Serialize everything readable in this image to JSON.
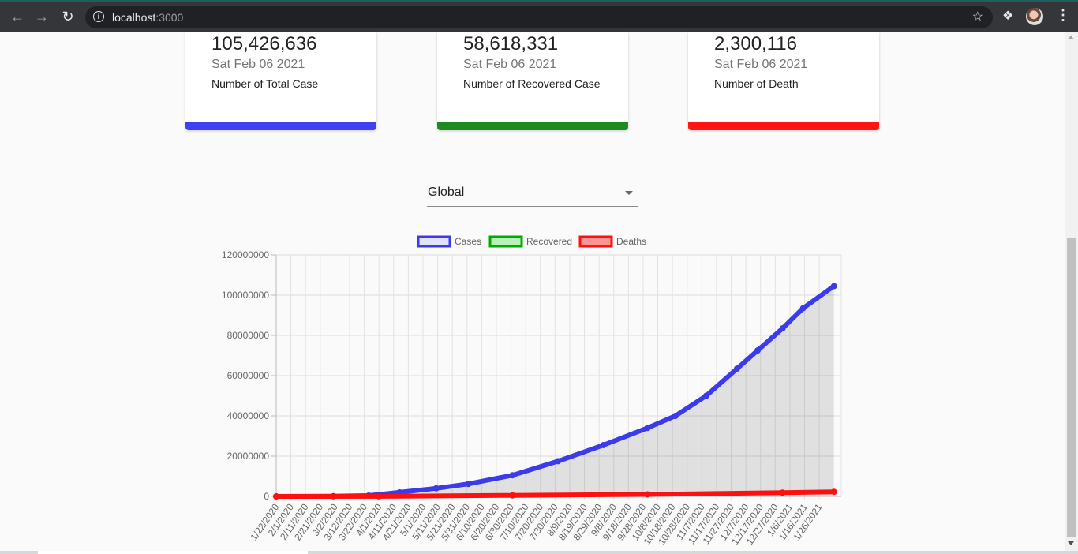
{
  "browser": {
    "url_host": "localhost",
    "url_port": ":3000"
  },
  "cards": [
    {
      "number": "105,426,636",
      "date": "Sat Feb 06 2021",
      "label": "Number of Total Case",
      "color": "#4040f0"
    },
    {
      "number": "58,618,331",
      "date": "Sat Feb 06 2021",
      "label": "Number of Recovered Case",
      "color": "#1e8a22"
    },
    {
      "number": "2,300,116",
      "date": "Sat Feb 06 2021",
      "label": "Number of Death",
      "color": "#ff1414"
    }
  ],
  "country_select": {
    "value": "Global"
  },
  "chart_data": {
    "type": "line",
    "legend_position": "top",
    "grid": true,
    "legend": [
      {
        "name": "Cases",
        "color": "#3b3bea",
        "fill": "rgba(90,90,240,0.15)"
      },
      {
        "name": "Recovered",
        "color": "#00aa00",
        "fill": "rgba(60,220,60,0.35)"
      },
      {
        "name": "Deaths",
        "color": "#ff1010",
        "fill": "rgba(255,80,80,0.6)"
      }
    ],
    "ylim": [
      0,
      120000000
    ],
    "yticks": [
      0,
      20000000,
      40000000,
      60000000,
      80000000,
      100000000,
      120000000
    ],
    "ytick_labels": [
      "0",
      "20000000",
      "40000000",
      "60000000",
      "80000000",
      "100000000",
      "120000000"
    ],
    "xtick_labels": [
      "1/22/2020",
      "2/1/2020",
      "2/11/2020",
      "2/21/2020",
      "3/2/2020",
      "3/12/2020",
      "3/22/2020",
      "4/1/2020",
      "4/11/2020",
      "4/21/2020",
      "5/1/2020",
      "5/11/2020",
      "5/21/2020",
      "5/31/2020",
      "6/10/2020",
      "6/20/2020",
      "6/30/2020",
      "7/10/2020",
      "7/20/2020",
      "7/30/2020",
      "8/9/2020",
      "8/19/2020",
      "8/29/2020",
      "9/8/2020",
      "9/18/2020",
      "9/28/2020",
      "10/8/2020",
      "10/18/2020",
      "10/28/2020",
      "11/7/2020",
      "11/17/2020",
      "11/27/2020",
      "12/7/2020",
      "12/17/2020",
      "12/27/2020",
      "1/6/2021",
      "1/16/2021",
      "1/26/2021"
    ],
    "series": [
      {
        "name": "Cases",
        "color": "#3b3bea",
        "x": [
          "1/22/2020",
          "3/1/2020",
          "3/25/2020",
          "4/15/2020",
          "5/10/2020",
          "6/1/2020",
          "7/1/2020",
          "8/1/2020",
          "9/1/2020",
          "10/1/2020",
          "10/20/2020",
          "11/10/2020",
          "12/1/2020",
          "12/15/2020",
          "1/1/2021",
          "1/15/2021",
          "2/5/2021"
        ],
        "values": [
          1000,
          90000,
          400000,
          2000000,
          4000000,
          6200000,
          10500000,
          17500000,
          25500000,
          34000000,
          40000000,
          50000000,
          63500000,
          72500000,
          83500000,
          93500000,
          104500000
        ]
      },
      {
        "name": "Deaths",
        "color": "#ff1010",
        "x": [
          "1/22/2020",
          "4/1/2020",
          "7/1/2020",
          "10/1/2020",
          "1/1/2021",
          "2/5/2021"
        ],
        "values": [
          0,
          50000,
          500000,
          1000000,
          1850000,
          2270000
        ]
      }
    ]
  }
}
